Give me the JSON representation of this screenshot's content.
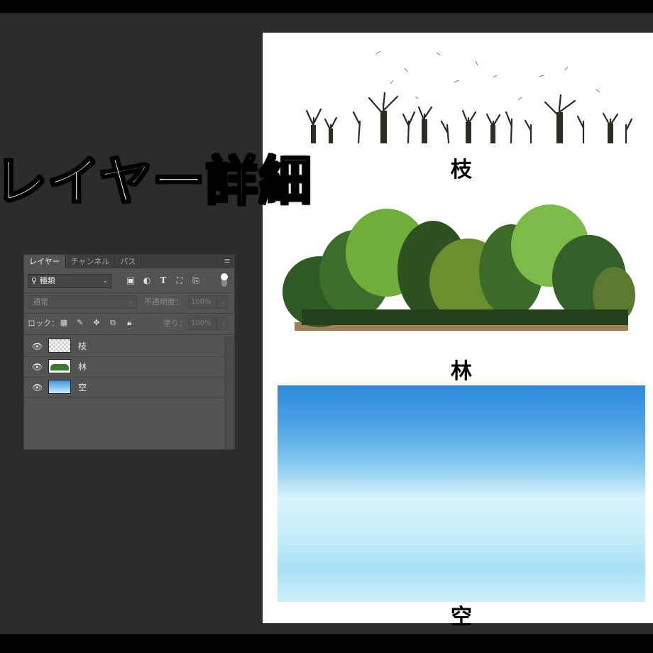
{
  "title": "レイヤー詳細",
  "panel": {
    "tabs": [
      {
        "label": "レイヤー",
        "active": true
      },
      {
        "label": "チャンネル",
        "active": false
      },
      {
        "label": "パス",
        "active": false
      }
    ],
    "kind_filter": "種類",
    "blend_mode": "通常",
    "opacity_label": "不透明度：",
    "opacity_value": "100%",
    "lock_label": "ロック：",
    "fill_label": "塗り：",
    "fill_value": "100%",
    "layers": [
      {
        "name": "枝",
        "thumb": "transparent",
        "visible": true
      },
      {
        "name": "林",
        "thumb": "forest",
        "visible": true
      },
      {
        "name": "空",
        "thumb": "sky",
        "visible": true
      }
    ]
  },
  "canvas": {
    "captions": {
      "branches": "枝",
      "forest": "林",
      "sky": "空"
    }
  }
}
